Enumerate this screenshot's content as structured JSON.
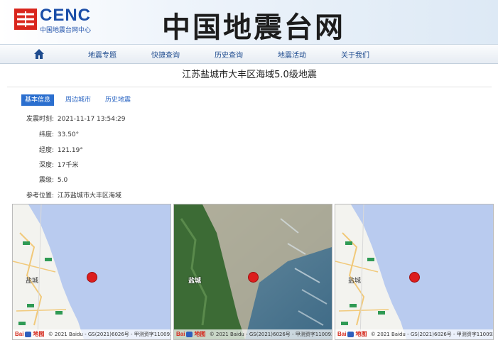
{
  "header": {
    "brand": "CENC",
    "brand_sub": "中国地震台网中心",
    "site_title": "中国地震台网"
  },
  "nav": {
    "home_icon": "home-icon",
    "items": [
      "地震专题",
      "快捷查询",
      "历史查询",
      "地震活动",
      "关于我们"
    ]
  },
  "event": {
    "title": "江苏盐城市大丰区海域5.0级地震"
  },
  "tabs": [
    "基本信息",
    "周边城市",
    "历史地震"
  ],
  "info": {
    "time_label": "发震时刻:",
    "time": "2021-11-17 13:54:29",
    "lat_label": "纬度:",
    "lat": "33.50°",
    "lon_label": "经度:",
    "lon": "121.19°",
    "depth_label": "深度:",
    "depth": "17千米",
    "mag_label": "震级:",
    "mag": "5.0",
    "ref_label": "参考位置:",
    "ref": "江苏盐城市大丰区海域"
  },
  "maps": {
    "city_label": "盐城",
    "baidu_logo": "Bai",
    "baidu_mark": "地图",
    "copyright_1": "© 2021 Baidu - GS(2021)6026号 - 甲测资字1100930 - 京",
    "copyright_2": "© 2021 Baidu - GS(2021)6026号 - 甲测资字1100930 - 京",
    "copyright_3": "© 2021 Baidu - GS(2021)6026号 - 甲测资字1100930 - 京"
  },
  "colors": {
    "brand_blue": "#1b4ea8",
    "logo_red": "#d9251c",
    "tab_active": "#2b6fcf",
    "sea": "#b7c9ef",
    "marker": "#dc1d1d"
  }
}
